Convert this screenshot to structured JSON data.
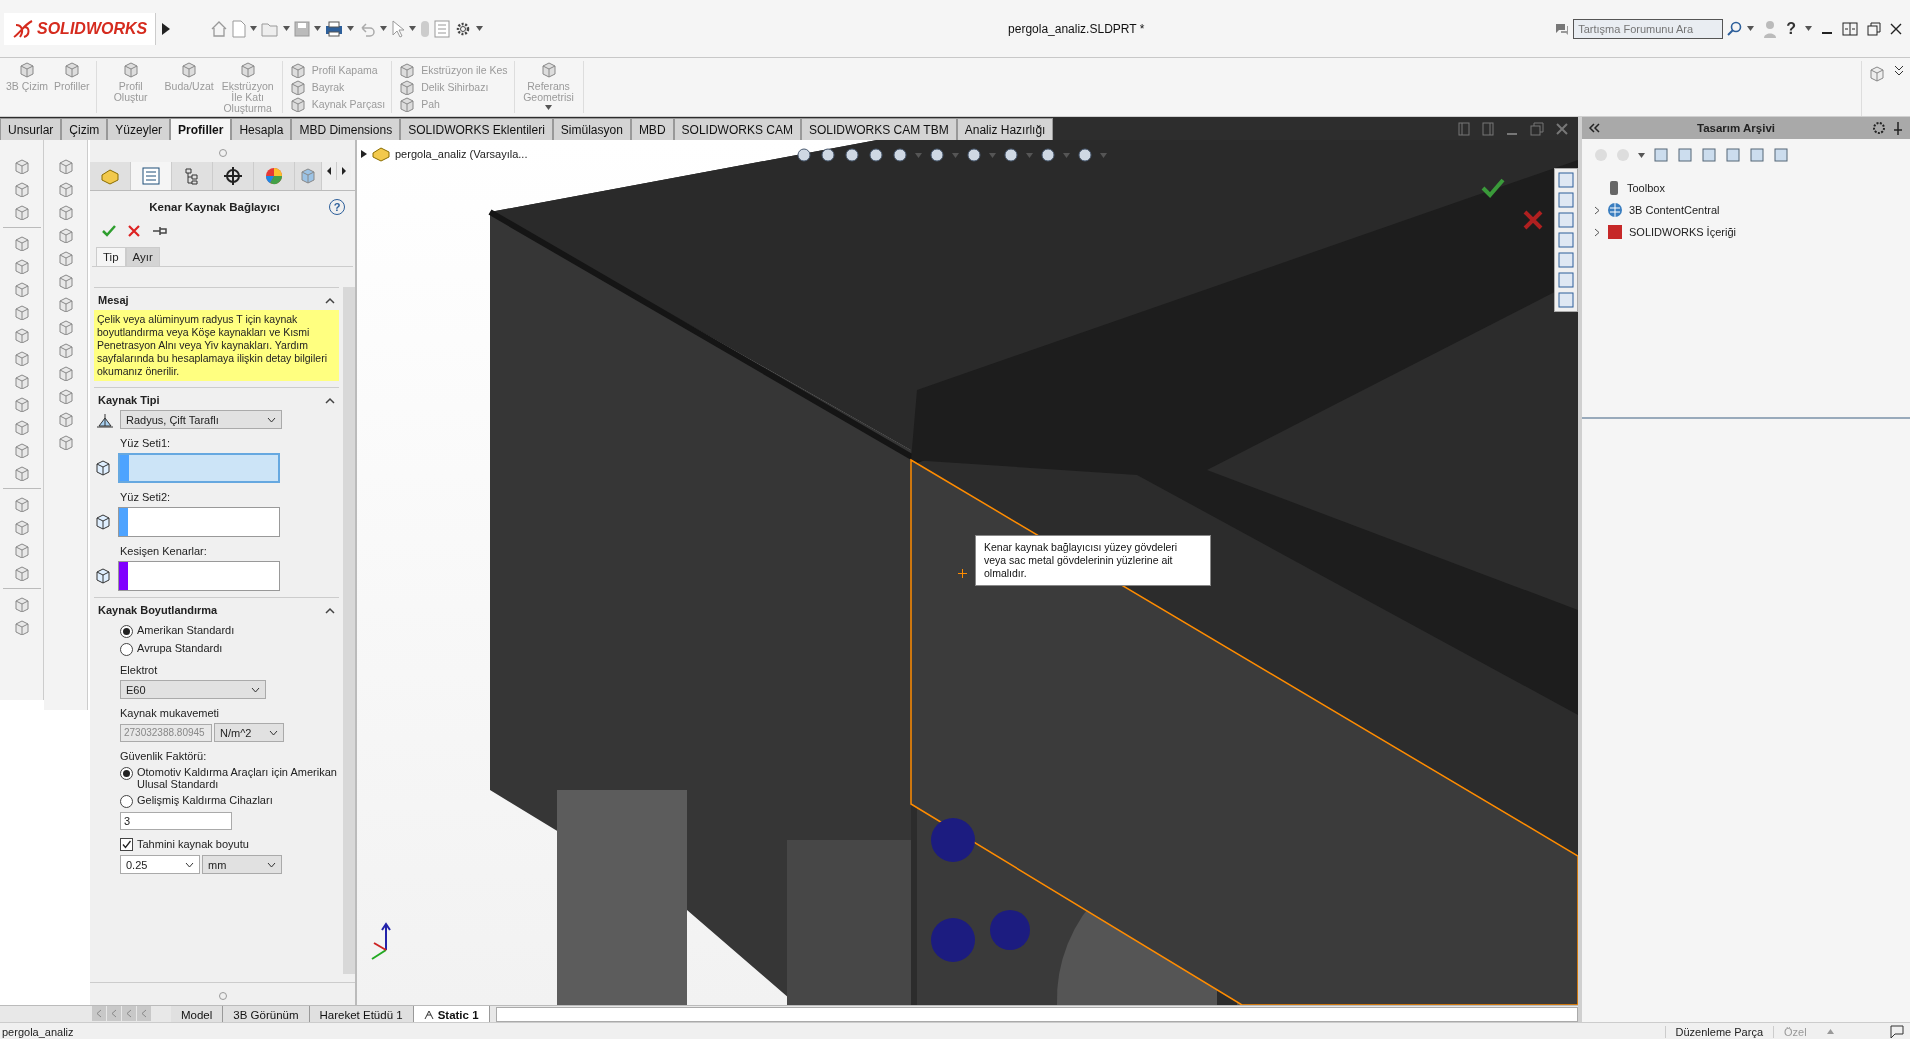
{
  "title_bar": {
    "logo": "SOLIDWORKS",
    "document_title": "pergola_analiz.SLDPRT *",
    "search": {
      "placeholder": "Tartışma Forumunu Ara"
    },
    "help": "?"
  },
  "ribbon": {
    "groups": [
      {
        "kind": "large",
        "items": [
          {
            "label": "3B Çizim"
          },
          {
            "label": "Profiller"
          }
        ]
      },
      {
        "kind": "large",
        "items": [
          {
            "label": "Profil Oluştur"
          },
          {
            "label": "Buda/Uzat"
          },
          {
            "label": "Ekstrüzyon İle Katı Oluşturma"
          }
        ]
      },
      {
        "kind": "small",
        "items": [
          {
            "label": "Profil Kapama"
          },
          {
            "label": "Bayrak"
          },
          {
            "label": "Kaynak Parçası"
          }
        ]
      },
      {
        "kind": "small",
        "items": [
          {
            "label": "Ekstrüzyon ile Kes"
          },
          {
            "label": "Delik Sihirbazı"
          },
          {
            "label": "Pah"
          }
        ]
      },
      {
        "kind": "large",
        "items": [
          {
            "label": "Referans Geometrisi"
          }
        ]
      }
    ]
  },
  "command_tabs": [
    {
      "label": "Unsurlar",
      "selected": false
    },
    {
      "label": "Çizim",
      "selected": false
    },
    {
      "label": "Yüzeyler",
      "selected": false
    },
    {
      "label": "Profiller",
      "selected": true
    },
    {
      "label": "Hesapla",
      "selected": false
    },
    {
      "label": "MBD Dimensions",
      "selected": false
    },
    {
      "label": "SOLIDWORKS Eklentileri",
      "selected": false
    },
    {
      "label": "Simülasyon",
      "selected": false
    },
    {
      "label": "MBD",
      "selected": false
    },
    {
      "label": "SOLIDWORKS CAM",
      "selected": false
    },
    {
      "label": "SOLIDWORKS CAM TBM",
      "selected": false
    },
    {
      "label": "Analiz Hazırlığı",
      "selected": false
    }
  ],
  "property_manager": {
    "title": "Kenar Kaynak Bağlayıcı",
    "help": "?",
    "tabs": [
      {
        "label": "Tip",
        "selected": true
      },
      {
        "label": "Ayır",
        "selected": false
      }
    ],
    "message": {
      "heading": "Mesaj",
      "text": "Çelik veya alüminyum radyus T için kaynak boyutlandırma veya Köşe kaynakları ve Kısmi Penetrasyon Alnı veya Yiv kaynakları. Yardım sayfalarında bu hesaplamaya ilişkin detay bilgileri okumanız önerilir."
    },
    "weld_type": {
      "heading": "Kaynak Tipi",
      "value": "Radyus, Çift Taraflı",
      "selections": [
        {
          "label": "Yüz Seti1:",
          "color": "#4da3ff",
          "active": true
        },
        {
          "label": "Yüz Seti2:",
          "color": "#4da3ff",
          "active": false
        },
        {
          "label": "Kesişen Kenarlar:",
          "color": "#8000ff",
          "active": false
        }
      ]
    },
    "sizing": {
      "heading": "Kaynak Boyutlandırma",
      "standards": [
        {
          "label": "Amerikan Standardı",
          "selected": true
        },
        {
          "label": "Avrupa Standardı",
          "selected": false
        }
      ],
      "electrode_label": "Elektrot",
      "electrode": "E60",
      "strength_label": "Kaynak mukavemeti",
      "strength_value": "273032388.80945",
      "strength_unit": "N/m^2",
      "safety_label": "Güvenlik Faktörü:",
      "safety_options": [
        {
          "label": "Otomotiv Kaldırma Araçları için Amerikan Ulusal Standardı",
          "selected": true
        },
        {
          "label": "Gelişmiş Kaldırma Cihazları",
          "selected": false
        }
      ],
      "safety_value": "3",
      "estimate": {
        "label": "Tahmini kaynak boyutu",
        "checked": true
      },
      "size_value": "0.25",
      "size_unit": "mm"
    }
  },
  "viewport": {
    "tree_root": "pergola_analiz (Varsayıla...",
    "tooltip": "Kenar kaynak bağlayıcısı yüzey gövdeleri veya sac metal gövdelerinin yüzlerine ait olmalıdır."
  },
  "design_library": {
    "title": "Tasarım Arşivi",
    "items": [
      {
        "label": "Toolbox",
        "expandable": false
      },
      {
        "label": "3B ContentCentral",
        "expandable": true
      },
      {
        "label": "SOLIDWORKS İçeriği",
        "expandable": true
      }
    ]
  },
  "bottom_tabs": [
    {
      "label": "Model",
      "selected": false
    },
    {
      "label": "3B Görünüm",
      "selected": false
    },
    {
      "label": "Hareket Etüdü 1",
      "selected": false
    },
    {
      "label": "Static 1",
      "selected": true
    }
  ],
  "status_bar": {
    "document": "pergola_analiz",
    "mode": "Düzenleme Parça",
    "units": "Özel"
  }
}
